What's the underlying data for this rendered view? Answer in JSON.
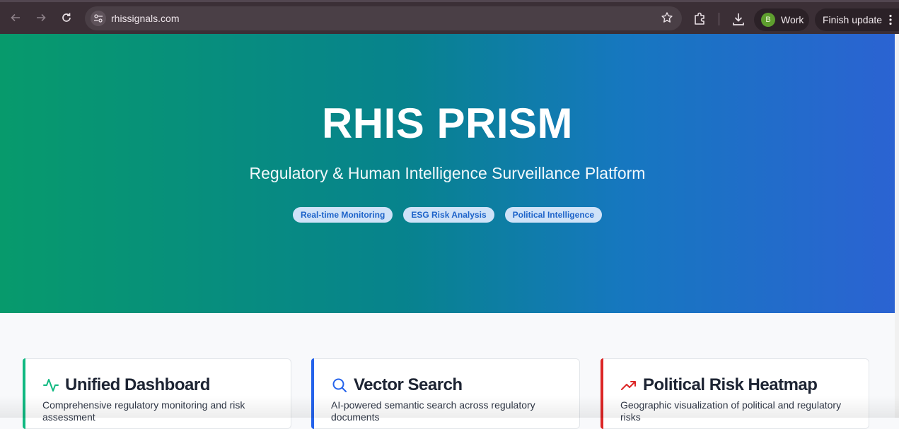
{
  "browser": {
    "url": "rhissignals.com",
    "profile_initial": "B",
    "profile_label": "Work",
    "update_label": "Finish update"
  },
  "hero": {
    "title": "RHIS PRISM",
    "subtitle": "Regulatory & Human Intelligence Surveillance Platform",
    "tags": [
      "Real-time Monitoring",
      "ESG Risk Analysis",
      "Political Intelligence"
    ]
  },
  "features": [
    {
      "title": "Unified Dashboard",
      "description": "Comprehensive regulatory monitoring and risk assessment",
      "icon": "activity-icon",
      "accent": "#10b981"
    },
    {
      "title": "Vector Search",
      "description": "AI-powered semantic search across regulatory documents",
      "icon": "search-icon",
      "accent": "#2563eb"
    },
    {
      "title": "Political Risk Heatmap",
      "description": "Geographic visualization of political and regulatory risks",
      "icon": "trending-up-icon",
      "accent": "#dc2626"
    }
  ],
  "colors": {
    "hero_start": "#079a6c",
    "hero_end": "#2b63d2",
    "pill_bg": "#cfe2f8",
    "pill_text": "#1d63c9"
  }
}
